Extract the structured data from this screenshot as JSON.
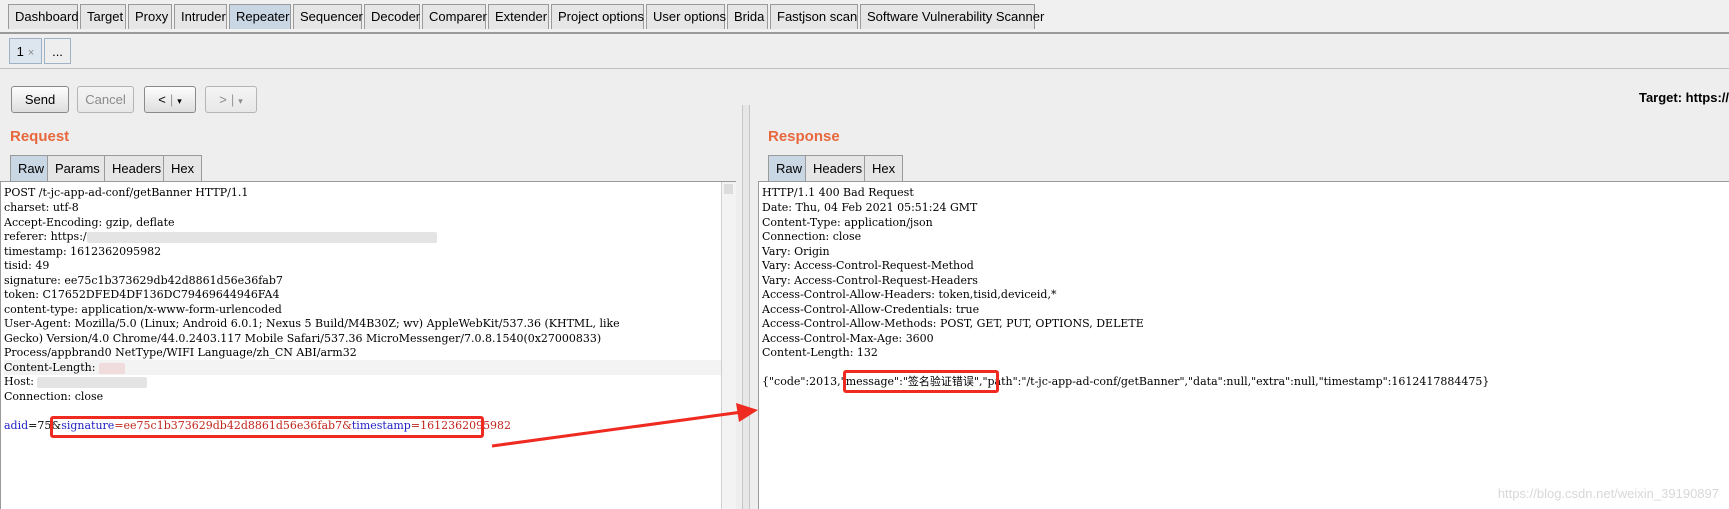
{
  "main_tabs": [
    "Dashboard",
    "Target",
    "Proxy",
    "Intruder",
    "Repeater",
    "Sequencer",
    "Decoder",
    "Comparer",
    "Extender",
    "Project options",
    "User options",
    "Brida",
    "Fastjson scan",
    "Software Vulnerability Scanner"
  ],
  "repeater_tabs": {
    "tab1": "1",
    "tab1_close": "×",
    "more": "..."
  },
  "toolbar": {
    "send": "Send",
    "cancel": "Cancel",
    "back": "<",
    "forward": ">",
    "dropdown": "▾",
    "target_label": "Target: https://"
  },
  "request": {
    "title": "Request",
    "tabs": [
      "Raw",
      "Params",
      "Headers",
      "Hex"
    ],
    "lines": [
      "POST /t-jc-app-ad-conf/getBanner HTTP/1.1",
      "charset: utf-8",
      "Accept-Encoding: gzip, deflate",
      "referer: https:/",
      "timestamp: 1612362095982",
      "tisid: 49",
      "signature: ee75c1b373629db42d8861d56e36fab7",
      "token: C17652DFED4DF136DC79469644946FA4",
      "content-type: application/x-www-form-urlencoded",
      "User-Agent: Mozilla/5.0 (Linux; Android 6.0.1; Nexus 5 Build/M4B30Z; wv) AppleWebKit/537.36 (KHTML, like",
      "Gecko) Version/4.0 Chrome/44.0.2403.117 Mobile Safari/537.36 MicroMessenger/7.0.8.1540(0x27000833)",
      "Process/appbrand0 NetType/WIFI Language/zh_CN ABI/arm32",
      "Content-Length: ",
      "Host: ",
      "Connection: close"
    ],
    "body": {
      "adid_key": "adid",
      "adid_val": "=75&",
      "sig_key": "signature",
      "sig_val": "=ee75c1b373629db42d8861d56e36fab7&",
      "ts_key": "timestamp",
      "ts_val": "=1612362095982"
    }
  },
  "response": {
    "title": "Response",
    "tabs": [
      "Raw",
      "Headers",
      "Hex"
    ],
    "lines": [
      "HTTP/1.1 400 Bad Request",
      "Date: Thu, 04 Feb 2021 05:51:24 GMT",
      "Content-Type: application/json",
      "Connection: close",
      "Vary: Origin",
      "Vary: Access-Control-Request-Method",
      "Vary: Access-Control-Request-Headers",
      "Access-Control-Allow-Headers: token,tisid,deviceid,*",
      "Access-Control-Allow-Credentials: true",
      "Access-Control-Allow-Methods: POST, GET, PUT, OPTIONS, DELETE",
      "Access-Control-Max-Age: 3600",
      "Content-Length: 132"
    ],
    "body": {
      "pre": "{\"code\":2013,",
      "msg": "\"message\":\"签名验证错误\"",
      "post": ",\"path\":\"/t-jc-app-ad-conf/getBanner\",\"data\":null,\"extra\":null,\"timestamp\":1612417884475}"
    }
  },
  "watermark": "https://blog.csdn.net/weixin_39190897",
  "colors": {
    "accent_orange": "#e8683d",
    "highlight_red": "#ef2a21",
    "param_blue": "#1f1fc4",
    "param_value_red": "#c0261b",
    "active_tab": "#c9d6e4"
  }
}
